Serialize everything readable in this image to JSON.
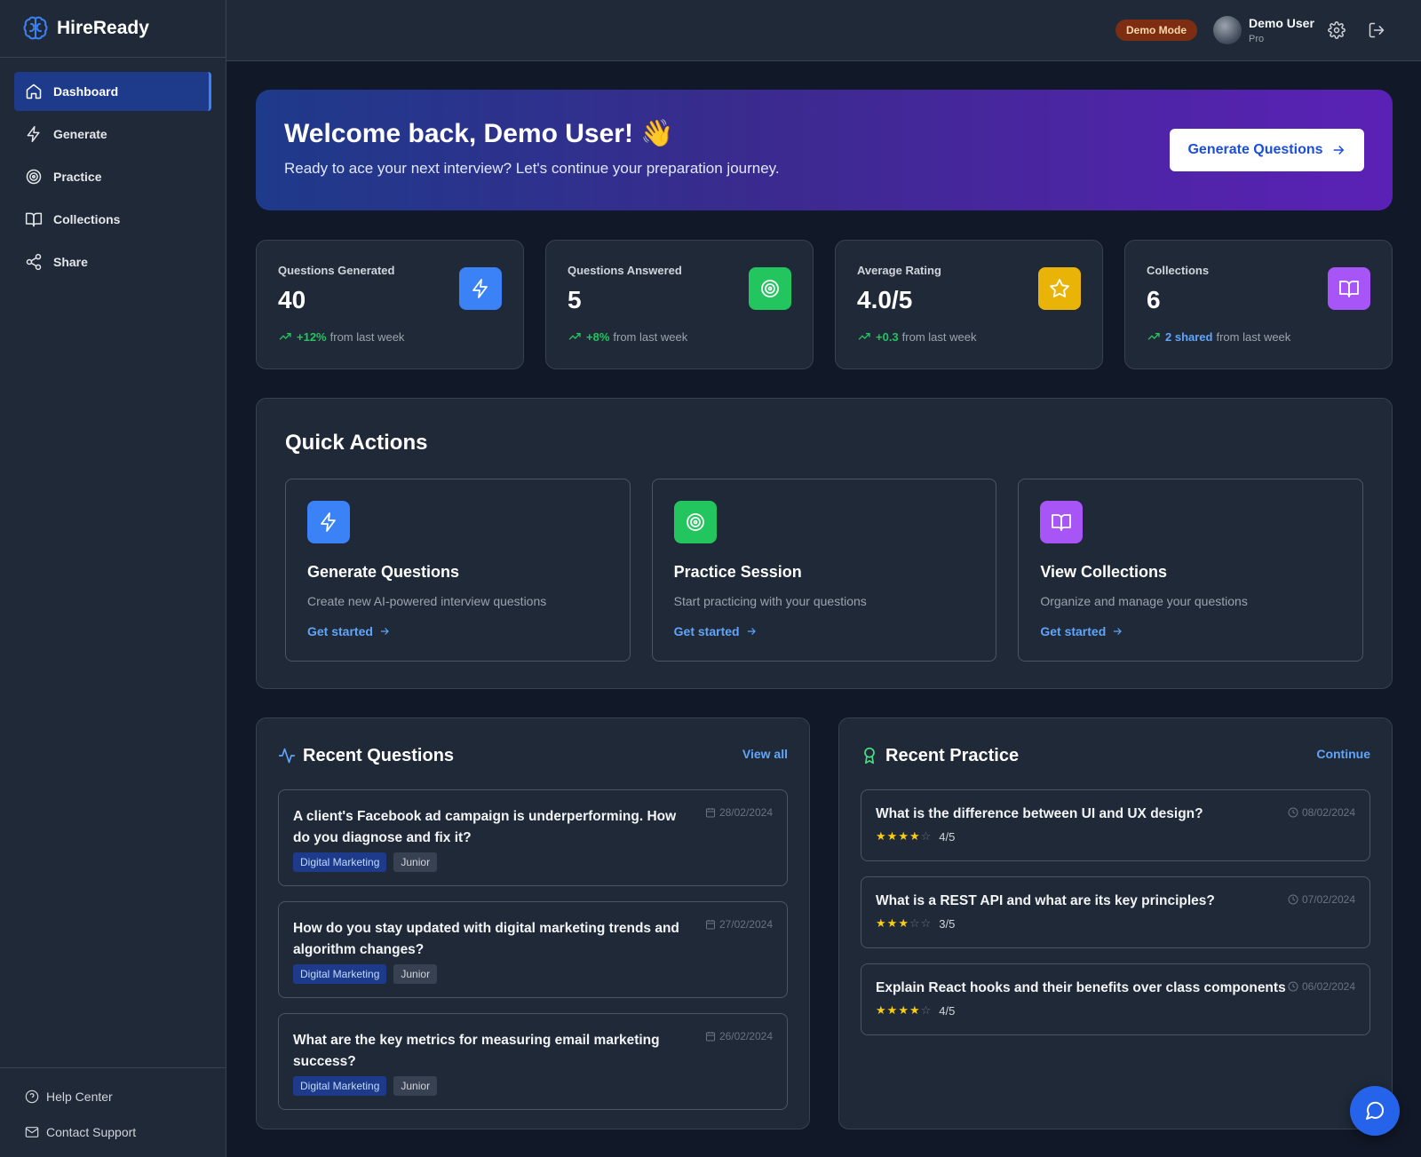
{
  "brand": {
    "name": "HireReady"
  },
  "sidebar": {
    "items": [
      {
        "label": "Dashboard",
        "icon": "home-icon",
        "active": true
      },
      {
        "label": "Generate",
        "icon": "lightning-icon"
      },
      {
        "label": "Practice",
        "icon": "target-icon"
      },
      {
        "label": "Collections",
        "icon": "book-icon"
      },
      {
        "label": "Share",
        "icon": "share-icon"
      }
    ],
    "bottom": [
      {
        "label": "Help Center",
        "icon": "help-circle-icon"
      },
      {
        "label": "Contact Support",
        "icon": "mail-icon"
      }
    ]
  },
  "header": {
    "badge": "Demo Mode",
    "user_name": "Demo User",
    "user_plan": "Pro",
    "badge_color": "#7c2d12"
  },
  "hero": {
    "title": "Welcome back, Demo User! 👋",
    "subtitle": "Ready to ace your next interview? Let's continue your preparation journey.",
    "button": "Generate Questions"
  },
  "stats": [
    {
      "label": "Questions Generated",
      "value": "40",
      "delta": "+12%",
      "suffix": "from last week",
      "color": "#3b82f6",
      "icon": "lightning-icon"
    },
    {
      "label": "Questions Answered",
      "value": "5",
      "delta": "+8%",
      "suffix": "from last week",
      "color": "#22c55e",
      "icon": "target-icon"
    },
    {
      "label": "Average Rating",
      "value": "4.0/5",
      "delta": "+0.3",
      "suffix": "from last week",
      "color": "#eab308",
      "icon": "star-icon"
    },
    {
      "label": "Collections",
      "value": "6",
      "delta": "2 shared",
      "suffix": "from last week",
      "color": "#a855f7",
      "icon": "book-icon"
    }
  ],
  "quick_actions": {
    "title": "Quick Actions",
    "cards": [
      {
        "title": "Generate Questions",
        "desc": "Create new AI-powered interview questions",
        "link": "Get started",
        "color": "#3b82f6",
        "icon": "lightning-icon"
      },
      {
        "title": "Practice Session",
        "desc": "Start practicing with your questions",
        "link": "Get started",
        "color": "#22c55e",
        "icon": "target-icon"
      },
      {
        "title": "View Collections",
        "desc": "Organize and manage your questions",
        "link": "Get started",
        "color": "#a855f7",
        "icon": "book-icon"
      }
    ]
  },
  "recent_questions": {
    "title": "Recent Questions",
    "link": "View all",
    "items": [
      {
        "text": "A client's Facebook ad campaign is underperforming. How do you diagnose and fix it?",
        "date": "28/02/2024",
        "topic": "Digital Marketing",
        "level": "Junior"
      },
      {
        "text": "How do you stay updated with digital marketing trends and algorithm changes?",
        "date": "27/02/2024",
        "topic": "Digital Marketing",
        "level": "Junior"
      },
      {
        "text": "What are the key metrics for measuring email marketing success?",
        "date": "26/02/2024",
        "topic": "Digital Marketing",
        "level": "Junior"
      }
    ]
  },
  "recent_practice": {
    "title": "Recent Practice",
    "link": "Continue",
    "items": [
      {
        "text": "What is the difference between UI and UX design?",
        "date": "08/02/2024",
        "rating": 4,
        "rating_label": "4/5"
      },
      {
        "text": "What is a REST API and what are its key principles?",
        "date": "07/02/2024",
        "rating": 3,
        "rating_label": "3/5"
      },
      {
        "text": "Explain React hooks and their benefits over class components",
        "date": "06/02/2024",
        "rating": 4,
        "rating_label": "4/5"
      }
    ]
  }
}
